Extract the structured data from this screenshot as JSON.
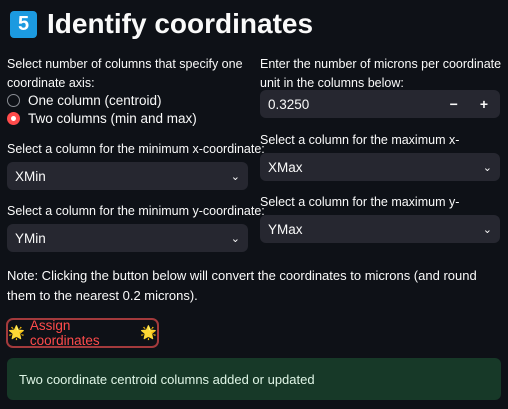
{
  "header": {
    "step": "5",
    "title": "Identify coordinates"
  },
  "left": {
    "radio_label": "Select number of columns that specify one coordinate axis:",
    "options": [
      {
        "label": "One column (centroid)",
        "selected": false
      },
      {
        "label": "Two columns (min and max)",
        "selected": true
      }
    ],
    "min_x_label": "Select a column for the minimum x-coordinate:",
    "min_x_value": "XMin",
    "min_y_label": "Select a column for the minimum y-coordinate:",
    "min_y_value": "YMin"
  },
  "right": {
    "microns_label": "Enter the number of microns per coordinate unit in the columns below:",
    "microns_value": "0.3250",
    "minus": "−",
    "plus": "+",
    "max_x_label": "Select a column for the maximum x-coordinate:",
    "max_x_value": "XMax",
    "max_y_label": "Select a column for the maximum y-coordinate:",
    "max_y_value": "YMax"
  },
  "note": "Note: Clicking the button below will convert the coordinates to microns (and round them to the nearest 0.2 microns).",
  "button": {
    "icon": "🌟",
    "label": "Assign coordinates"
  },
  "success": "Two coordinate centroid columns added or updated"
}
